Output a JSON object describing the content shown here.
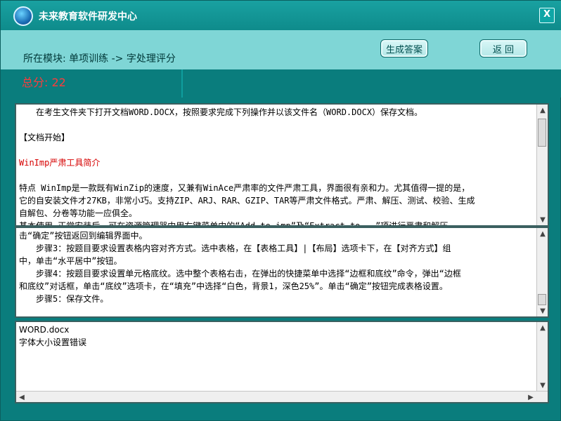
{
  "app": {
    "title": "未来教育软件研发中心",
    "close_glyph": "X"
  },
  "module": {
    "label": "所在模块: 单项训练 -> 字处理评分"
  },
  "buttons": {
    "generate_answer": "生成答案",
    "back": "返  回"
  },
  "score": {
    "text": "总分: 22"
  },
  "panel1": {
    "lines": [
      "在考生文件夹下打开文档WORD.DOCX，按照要求完成下列操作并以该文件名（WORD.DOCX）保存文档。",
      "",
      "【文档开始】",
      "",
      "WinImp严肃工具简介",
      "",
      "特点  WinImp是一款既有WinZip的速度，又兼有WinAce严肃率的文件严肃工具，界面很有亲和力。尤其值得一提的是，",
      "它的自安装文件才27KB，非常小巧。支持ZIP、ARJ、RAR、GZIP、TAR等严肃文件格式。严肃、解压、测试、校验、生成",
      "自解包、分卷等功能一应俱全。",
      "基本使用  正常安装后，可在资源管理器中用右键菜单中的“Add to imp”及“Extract to...”项进行严肃和解压。"
    ]
  },
  "panel2": {
    "lines": [
      "击“确定”按钮返回到编辑界面中。",
      "步骤3：按题目要求设置表格内容对齐方式。选中表格，在【表格工具】|【布局】选项卡下，在【对齐方式】组",
      "中，单击“水平居中”按钮。",
      "步骤4：按题目要求设置单元格底纹。选中整个表格右击，在弹出的快捷菜单中选择“边框和底纹”命令，弹出“边框",
      "和底纹”对话框，单击“底纹”选项卡，在“填充”中选择“白色，背景1，深色25%”。单击“确定”按钮完成表格设置。",
      "步骤5：保存文件。"
    ]
  },
  "panel3": {
    "lines": [
      "WORD.docx",
      "字体大小设置错误"
    ]
  },
  "colors": {
    "background": "#0a7d7d",
    "band": "#7fd6d6",
    "score_red": "#ff3b3b",
    "title_red": "#d60000"
  }
}
